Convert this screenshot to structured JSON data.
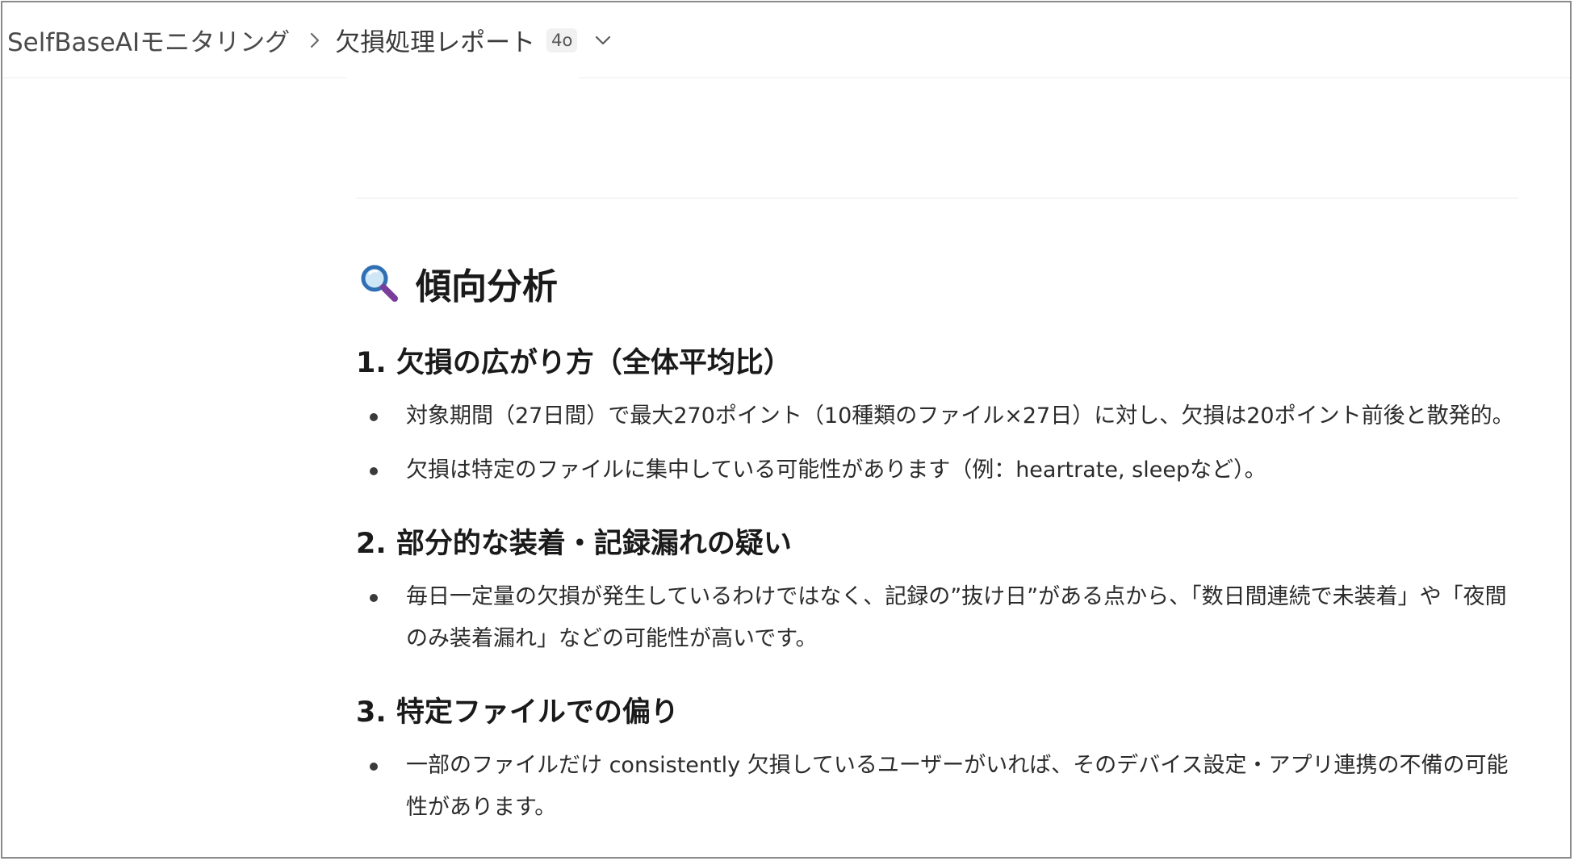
{
  "header": {
    "breadcrumb_root": "SelfBaseAIモニタリング",
    "current_title": "欠損処理レポート",
    "model_badge": "4o",
    "separator_icon": "chevron-right-icon",
    "model_menu_icon": "chevron-down-icon"
  },
  "report": {
    "section_icon": "magnifier-icon",
    "section_title": "傾向分析",
    "items": [
      {
        "heading": "1. 欠損の広がり方（全体平均比）",
        "bullets": [
          "対象期間（27日間）で最大270ポイント（10種類のファイル×27日）に対し、欠損は20ポイント前後と散発的。",
          "欠損は特定のファイルに集中している可能性があります（例：heartrate, sleepなど）。"
        ]
      },
      {
        "heading": "2. 部分的な装着・記録漏れの疑い",
        "bullets": [
          "毎日一定量の欠損が発生しているわけではなく、記録の”抜け日”がある点から、「数日間連続で未装着」や「夜間のみ装着漏れ」などの可能性が高いです。"
        ]
      },
      {
        "heading": "3. 特定ファイルでの偏り",
        "bullets": [
          "一部のファイルだけ consistently 欠損しているユーザーがいれば、そのデバイス設定・アプリ連携の不備の可能性があります。"
        ]
      }
    ]
  }
}
